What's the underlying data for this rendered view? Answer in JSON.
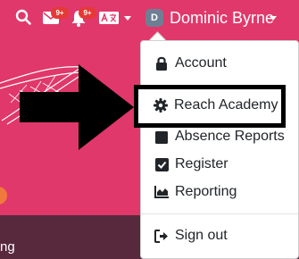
{
  "navbar": {
    "search_icon": "search-icon",
    "mail": {
      "icon": "envelope-icon",
      "badge": "9+"
    },
    "notifications": {
      "icon": "bell-icon",
      "badge": "9+"
    },
    "language": {
      "icon": "translate-icon"
    },
    "user": {
      "avatar_initial": "D",
      "name": "Dominic Byrne"
    }
  },
  "dropdown": {
    "items": [
      {
        "label": "Account",
        "icon": "lock-icon"
      },
      {
        "label": "Reach Academy",
        "icon": "gear-icon"
      },
      {
        "label": "Absence Reports",
        "icon": "calendar-icon"
      },
      {
        "label": "Register",
        "icon": "checkbox-icon"
      },
      {
        "label": "Reporting",
        "icon": "chart-icon"
      },
      {
        "label": "Sign out",
        "icon": "sign-out-icon"
      }
    ]
  },
  "background": {
    "bottom_text": "ng"
  },
  "colors": {
    "page_bg": "#e0386a",
    "bottom_bar": "#58293d",
    "badge": "#e53935",
    "accent_dot": "#f07a3c"
  }
}
